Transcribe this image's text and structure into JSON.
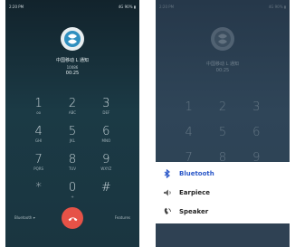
{
  "left_phone": {
    "status_left": "2:20 PM",
    "status_right": "4G 90% ▮",
    "caller": {
      "name": "中国移动 L 通知",
      "number": "10086",
      "duration": "00:25"
    },
    "keypad": [
      {
        "digit": "1",
        "letters": "ᴏᴏ"
      },
      {
        "digit": "2",
        "letters": "ABC"
      },
      {
        "digit": "3",
        "letters": "DEF"
      },
      {
        "digit": "4",
        "letters": "GHI"
      },
      {
        "digit": "5",
        "letters": "JKL"
      },
      {
        "digit": "6",
        "letters": "MNO"
      },
      {
        "digit": "7",
        "letters": "PQRS"
      },
      {
        "digit": "8",
        "letters": "TUV"
      },
      {
        "digit": "9",
        "letters": "WXYZ"
      },
      {
        "digit": "*",
        "letters": ""
      },
      {
        "digit": "0",
        "letters": "+"
      },
      {
        "digit": "#",
        "letters": ""
      }
    ],
    "bottom": {
      "audio_route_label": "Bluetooth ▾",
      "features_label": "Features"
    }
  },
  "right_phone": {
    "status_left": "2:20 PM",
    "status_right": "4G 90% ▮",
    "caller": {
      "name": "中国移动 L 通知",
      "duration": "00:25"
    },
    "keypad": [
      "1",
      "2",
      "3",
      "4",
      "5",
      "6",
      "7",
      "8",
      "9",
      "*",
      "0",
      "#"
    ],
    "audio_options": [
      {
        "label": "Bluetooth",
        "icon": "bluetooth-icon"
      },
      {
        "label": "Earpiece",
        "icon": "earpiece-icon"
      },
      {
        "label": "Speaker",
        "icon": "speaker-icon"
      }
    ]
  },
  "colors": {
    "end_call": "#e65247",
    "selected_option": "#2a57c8"
  }
}
